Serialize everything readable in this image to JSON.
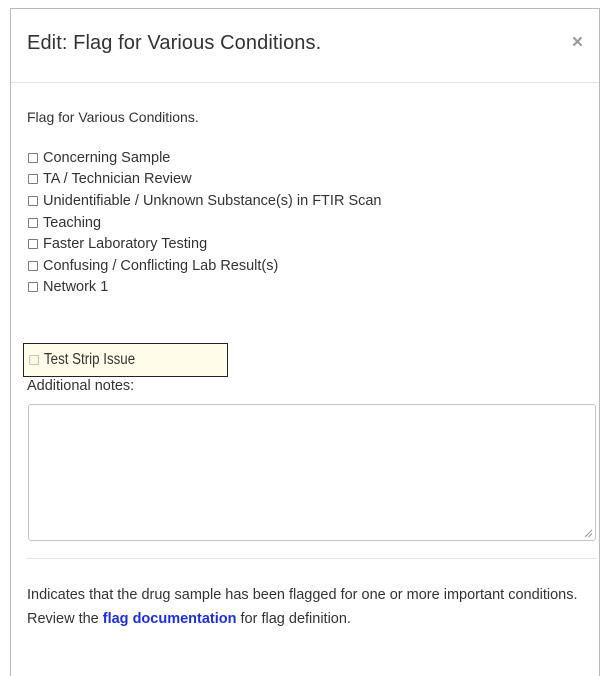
{
  "modal": {
    "title": "Edit: Flag for Various Conditions.",
    "close_label": "×"
  },
  "form": {
    "label": "Flag for Various Conditions.",
    "options": [
      {
        "label": "Concerning Sample",
        "checked": false
      },
      {
        "label": "TA / Technician Review",
        "checked": false
      },
      {
        "label": "Unidentifiable / Unknown Substance(s) in FTIR Scan",
        "checked": false
      },
      {
        "label": "Teaching",
        "checked": false
      },
      {
        "label": "Faster Laboratory Testing",
        "checked": false
      },
      {
        "label": "Confusing / Conflicting Lab Result(s)",
        "checked": false
      },
      {
        "label": "Network 1",
        "checked": false
      }
    ],
    "highlighted_option": {
      "label": "Test Strip Issue",
      "checked": false
    },
    "notes_label": "Additional notes:",
    "notes_value": "",
    "notes_placeholder": ""
  },
  "help": {
    "text_before": "Indicates that the drug sample has been flagged for one or more important conditions. Review the ",
    "link_text": "flag documentation",
    "text_after": " for flag definition."
  },
  "colors": {
    "link": "#1c2fe0",
    "highlight_bg": "#fffde9"
  }
}
